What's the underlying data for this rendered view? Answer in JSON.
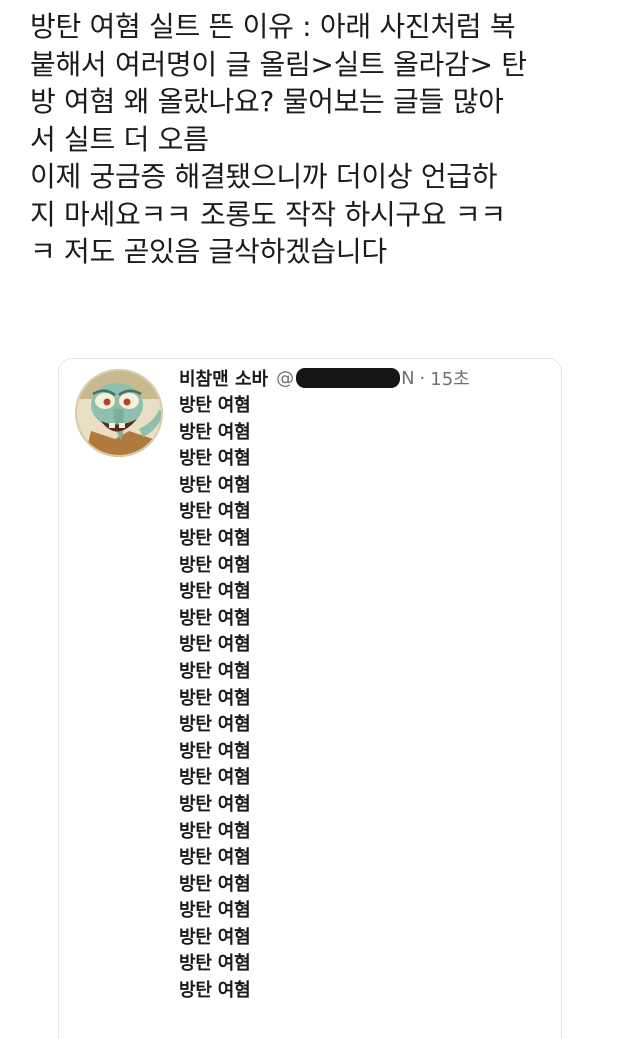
{
  "post": {
    "lines": [
      "방탄 여혐 실트 뜬 이유 : 아래 사진처럼 복",
      "붙해서 여러명이 글 올림>실트 올라감> 탄",
      "방 여혐 왜 올랐나요? 물어보는 글들 많아",
      "서 실트 더 오름",
      "이제 궁금증 해결됐으니까 더이상 언급하",
      "지 마세요ㅋㅋ 조롱도 작작 하시구요 ㅋㅋ",
      "ㅋ 저도 곧있음 글삭하겠습니다"
    ]
  },
  "quoted_tweet": {
    "display_name": "비참맨 소바",
    "handle_prefix": "@",
    "handle_suffix": "N",
    "separator": "·",
    "timestamp": "15초",
    "avatar_icon": "squidward-avatar-icon",
    "body_lines": [
      "방탄 여혐",
      "방탄 여혐",
      "방탄 여혐",
      "방탄 여혐",
      "방탄 여혐",
      "방탄 여혐",
      "방탄 여혐",
      "방탄 여혐",
      "방탄 여혐",
      "방탄 여혐",
      "방탄 여혐",
      "방탄 여혐",
      "방탄 여혐",
      "방탄 여혐",
      "방탄 여혐",
      "방탄 여혐",
      "방탄 여혐",
      "방탄 여혐",
      "방탄 여혐",
      "방탄 여혐",
      "방탄 여혐",
      "방탄 여혐",
      "방탄 여혐"
    ]
  }
}
